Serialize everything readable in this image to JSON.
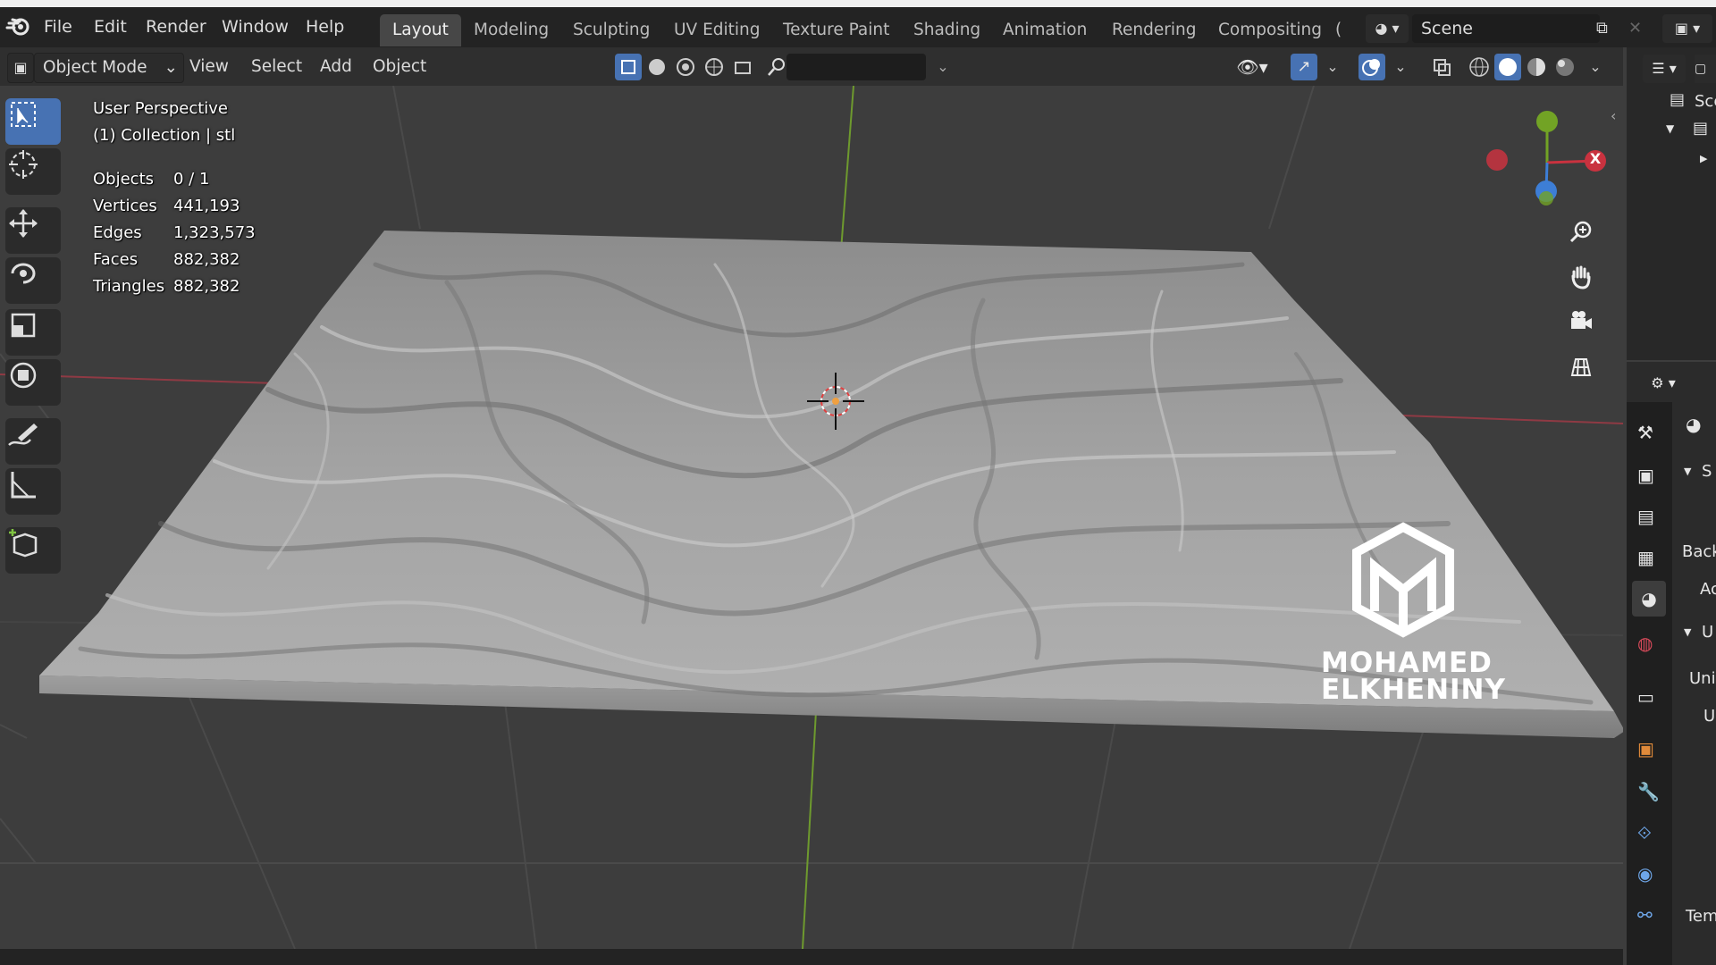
{
  "menu": {
    "file": "File",
    "edit": "Edit",
    "render": "Render",
    "window": "Window",
    "help": "Help"
  },
  "workspaces": [
    "Layout",
    "Modeling",
    "Sculpting",
    "UV Editing",
    "Texture Paint",
    "Shading",
    "Animation",
    "Rendering",
    "Compositing",
    "("
  ],
  "active_workspace": "Layout",
  "scene": {
    "label": "Scene"
  },
  "header": {
    "mode": "Object Mode",
    "view": "View",
    "select": "Select",
    "add": "Add",
    "object": "Object",
    "search_value": ""
  },
  "viewport": {
    "perspective": "User Perspective",
    "collection": "(1) Collection | stl"
  },
  "stats": [
    {
      "label": "Objects",
      "value": "0 / 1"
    },
    {
      "label": "Vertices",
      "value": "441,193"
    },
    {
      "label": "Edges",
      "value": "1,323,573"
    },
    {
      "label": "Faces",
      "value": "882,382"
    },
    {
      "label": "Triangles",
      "value": "882,382"
    }
  ],
  "gizmo": {
    "x": "X"
  },
  "watermark": {
    "line1": "MOHAMED",
    "line2": "ELKHENINY"
  },
  "outliner": {
    "item": "Sce"
  },
  "properties": {
    "section1": "S",
    "back": "Back",
    "ac": "Ac",
    "section2": "U",
    "uni": "Uni",
    "u": "U",
    "tem": "Tem"
  },
  "colors": {
    "accent": "#4772b3",
    "x_axis": "#c9323f",
    "y_axis": "#72a325",
    "z_axis": "#3d7ed6",
    "mesh": "#9a9a9a",
    "background": "#3d3d3d"
  },
  "icons": [
    "blender-logo-icon",
    "select-box-icon",
    "cursor-icon",
    "move-icon",
    "rotate-icon",
    "scale-icon",
    "transform-icon",
    "annotate-icon",
    "measure-icon",
    "add-cube-icon",
    "zoom-icon",
    "hand-icon",
    "camera-icon",
    "grid-icon"
  ]
}
